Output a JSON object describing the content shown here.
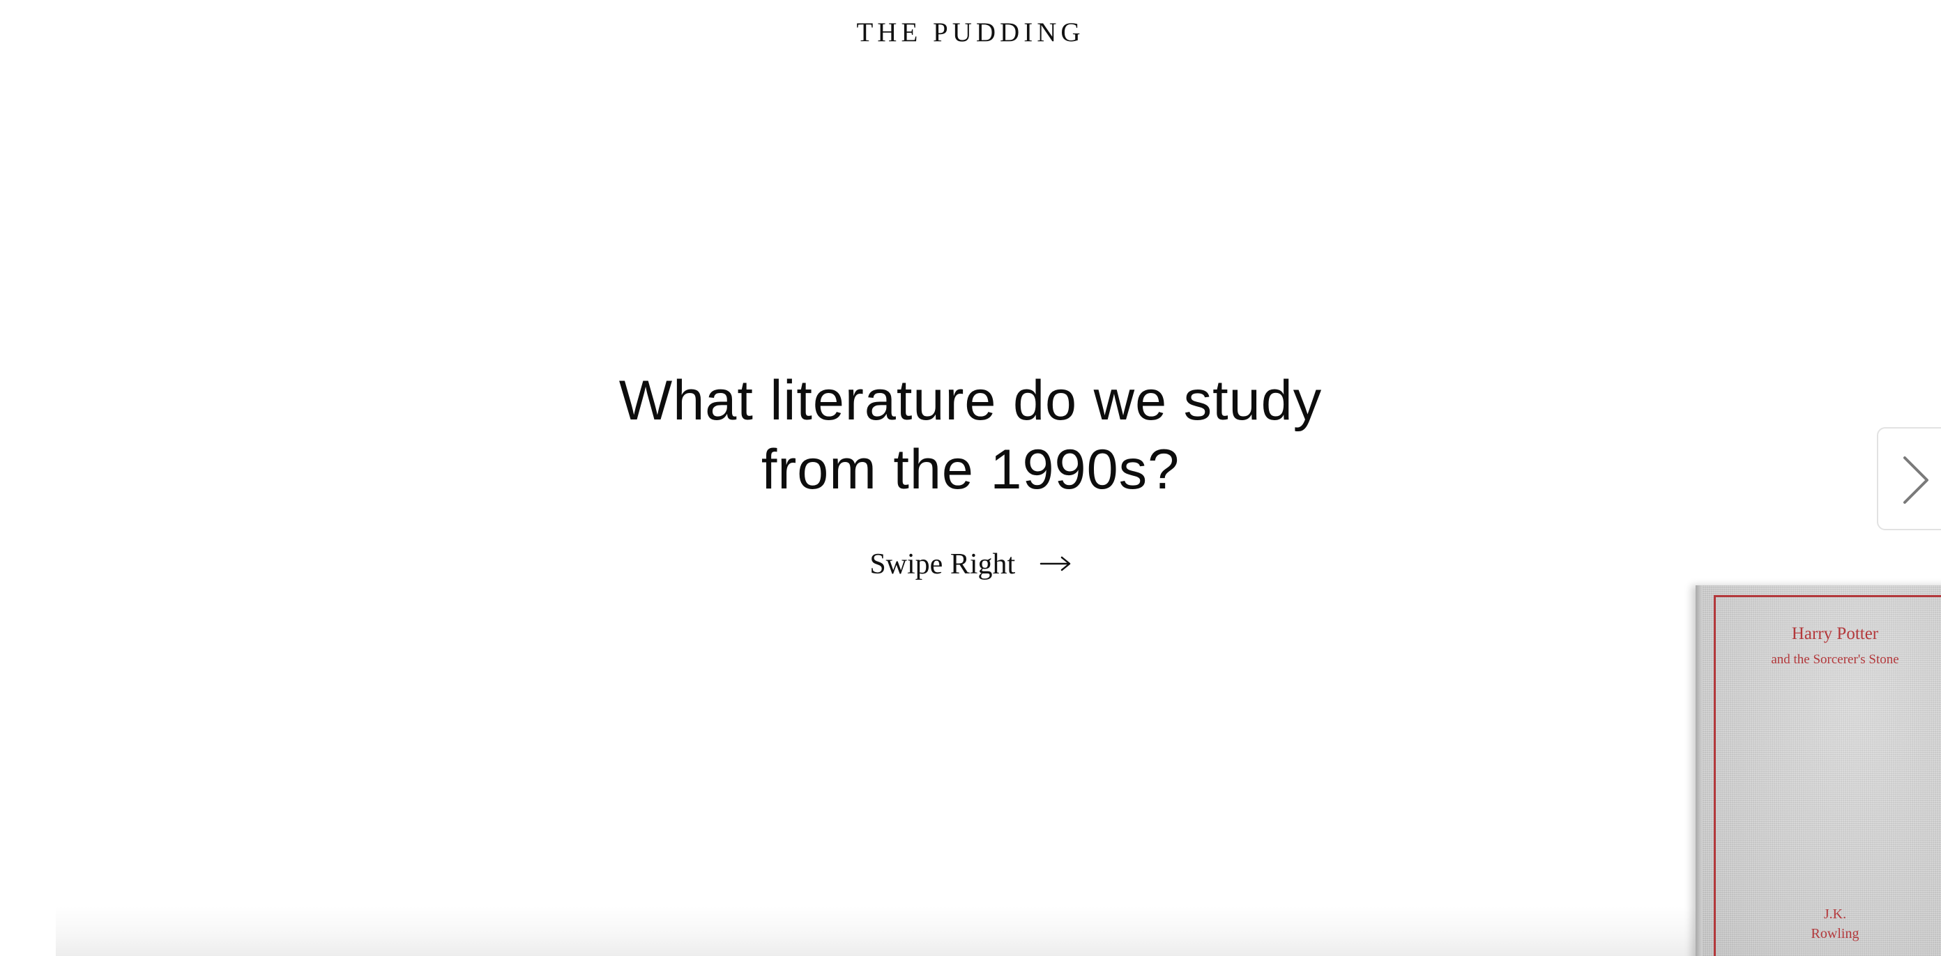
{
  "header": {
    "site_name": "THE PUDDING"
  },
  "hero": {
    "headline_line1": "What literature do we study",
    "headline_line2": "from the 1990s?",
    "cta_label": "Swipe Right",
    "cta_icon": "arrow-right-icon"
  },
  "carousel": {
    "next_icon": "chevron-right-icon",
    "current_book": {
      "title": "Harry Potter",
      "subtitle": "and the Sorcerer's Stone",
      "author_line1": "J.K.",
      "author_line2": "Rowling"
    }
  },
  "colors": {
    "background": "#ffffff",
    "text": "#111111",
    "book_cloth": "#cfcfcf",
    "book_accent": "#b3383b",
    "button_border": "#e2e2e2"
  }
}
